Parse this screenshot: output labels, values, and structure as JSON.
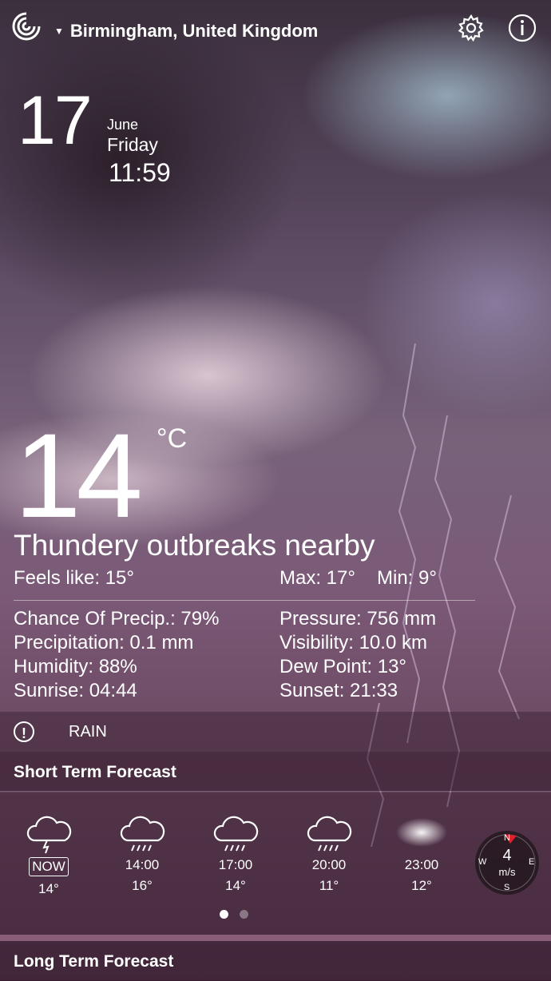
{
  "header": {
    "location": "Birmingham, United Kingdom",
    "caret": "▼"
  },
  "date": {
    "day": "17",
    "month": "June",
    "weekday": "Friday",
    "time": "11:59"
  },
  "current": {
    "temperature": "14",
    "unit": "°C",
    "condition": "Thundery outbreaks nearby",
    "feels_like": "Feels like: 15°",
    "max": "Max: 17°",
    "min": "Min: 9°"
  },
  "details": {
    "left": [
      "Chance Of Precip.: 79%",
      "Precipitation: 0.1 mm",
      "Humidity: 88%",
      "Sunrise: 04:44"
    ],
    "right": [
      "Pressure: 756 mm",
      "Visibility: 10.0 km",
      "Dew Point: 13°",
      "Sunset: 21:33"
    ]
  },
  "alert": {
    "icon": "!",
    "text": "RAIN"
  },
  "short_term": {
    "title": "Short Term Forecast",
    "items": [
      {
        "time": "NOW",
        "temp": "14°",
        "icon": "thunder-cloud-icon"
      },
      {
        "time": "14:00",
        "temp": "16°",
        "icon": "rain-cloud-icon"
      },
      {
        "time": "17:00",
        "temp": "14°",
        "icon": "rain-cloud-icon"
      },
      {
        "time": "20:00",
        "temp": "11°",
        "icon": "rain-cloud-icon"
      },
      {
        "time": "23:00",
        "temp": "12°",
        "icon": "fog-cloud-icon"
      }
    ],
    "wind": {
      "speed": "4",
      "unit": "m/s",
      "n": "N",
      "e": "E",
      "s": "S",
      "w": "W"
    },
    "pages": 2,
    "active_page": 1
  },
  "long_term": {
    "title": "Long Term Forecast"
  },
  "colors": {
    "accent": "#e0202a"
  }
}
